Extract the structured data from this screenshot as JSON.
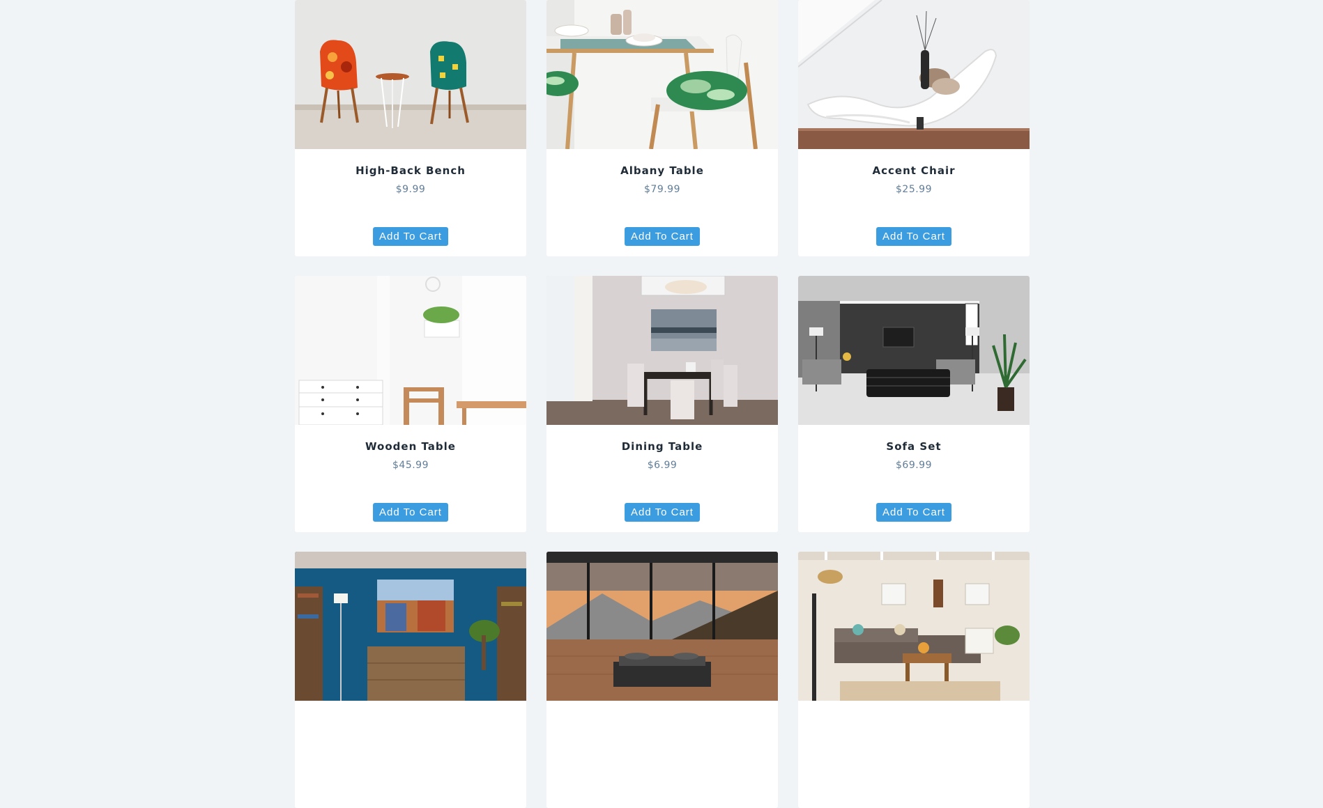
{
  "products": [
    {
      "name": "High-Back Bench",
      "price": "$9.99",
      "button": "Add To Cart"
    },
    {
      "name": "Albany Table",
      "price": "$79.99",
      "button": "Add To Cart"
    },
    {
      "name": "Accent Chair",
      "price": "$25.99",
      "button": "Add To Cart"
    },
    {
      "name": "Wooden Table",
      "price": "$45.99",
      "button": "Add To Cart"
    },
    {
      "name": "Dining Table",
      "price": "$6.99",
      "button": "Add To Cart"
    },
    {
      "name": "Sofa Set",
      "price": "$69.99",
      "button": "Add To Cart"
    },
    {
      "name": "",
      "price": "",
      "button": ""
    },
    {
      "name": "",
      "price": "",
      "button": ""
    },
    {
      "name": "",
      "price": "",
      "button": ""
    }
  ],
  "colors": {
    "page_background": "#f0f4f7",
    "card_background": "#ffffff",
    "button": "#3b9de0",
    "title": "#1f2b37",
    "price": "#617d98"
  }
}
